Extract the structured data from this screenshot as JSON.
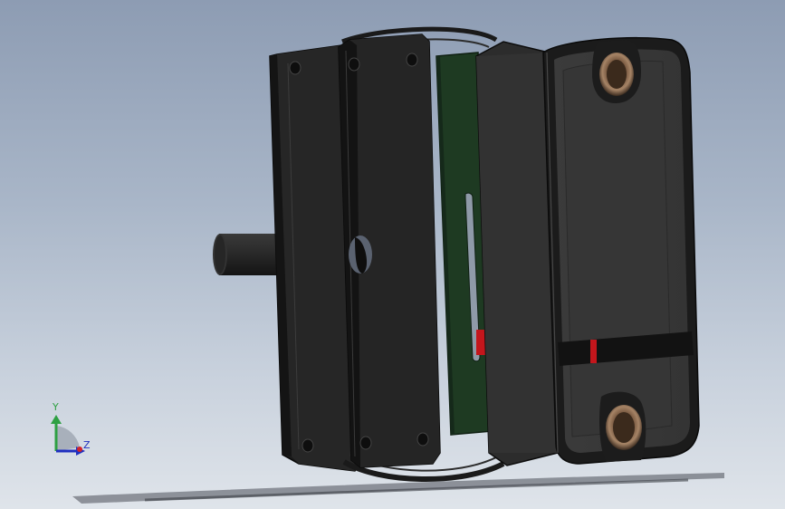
{
  "viewport": {
    "background_top": "#8d9cb3",
    "background_bottom": "#dfe4ea"
  },
  "triad": {
    "y_label": "Y",
    "z_label": "Z",
    "x_color": "#d2232a",
    "y_color": "#2ea043",
    "z_color": "#1f2fbf"
  },
  "parts": {
    "shaft": "shaft",
    "back_plate": "back-plate",
    "gasket": "gasket-ring",
    "mid_plate": "mid-plate",
    "pcb": "circuit-board",
    "housing": "front-housing",
    "led_color": "#c4161c",
    "pcb_color": "#1e3a22",
    "grommet_color": "#8a6a4e"
  }
}
